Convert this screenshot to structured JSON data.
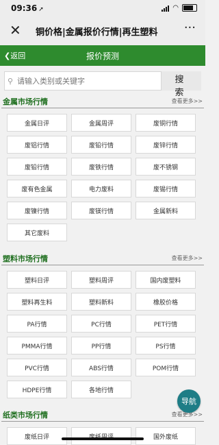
{
  "status": {
    "time": "09:36"
  },
  "window": {
    "title": "铜价格|金属报价行情|再生塑料"
  },
  "header": {
    "back": "返回",
    "title": "报价预测"
  },
  "search": {
    "placeholder": "请输入类别或关键字",
    "button": "搜 索"
  },
  "sections": [
    {
      "title": "金属市场行情",
      "more": "查看更多>>",
      "items": [
        "金属日评",
        "金属周评",
        "废铜行情",
        "废铝行情",
        "废铅行情",
        "废锌行情",
        "废铅行情",
        "废铁行情",
        "废不锈钢",
        "废有色金属",
        "电力废料",
        "废锡行情",
        "废镍行情",
        "废镁行情",
        "金属新料",
        "其它废料"
      ]
    },
    {
      "title": "塑料市场行情",
      "more": "查看更多>>",
      "items": [
        "塑料日评",
        "塑料周评",
        "国内废塑料",
        "塑料再生料",
        "塑料新料",
        "橡胶价格",
        "PA行情",
        "PC行情",
        "PET行情",
        "PMMA行情",
        "PP行情",
        "PS行情",
        "PVC行情",
        "ABS行情",
        "POM行情",
        "HDPE行情",
        "各地行情"
      ]
    },
    {
      "title": "纸类市场行情",
      "more": "查看更多>>",
      "items": [
        "废纸日评",
        "废纸周评",
        "国外废纸"
      ]
    }
  ],
  "float_nav": "导航"
}
